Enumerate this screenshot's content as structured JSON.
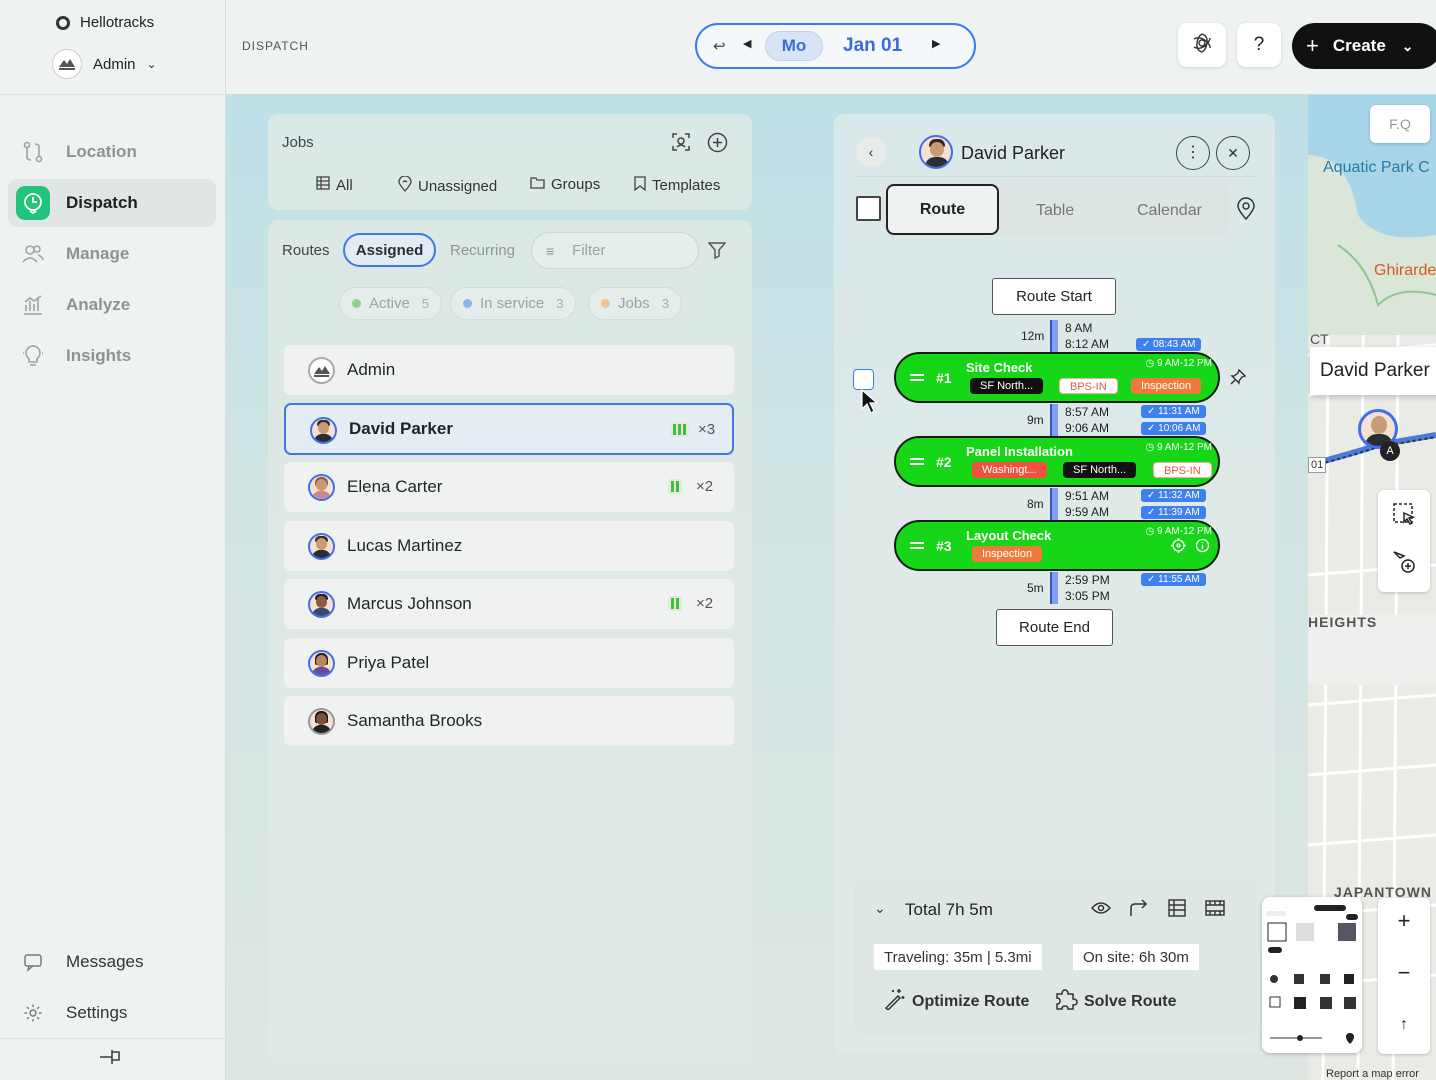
{
  "app": {
    "name": "Hellotracks",
    "user": "Admin"
  },
  "nav": {
    "items": [
      "Location",
      "Dispatch",
      "Manage",
      "Analyze",
      "Insights"
    ],
    "bottom": [
      "Messages",
      "Settings"
    ]
  },
  "header": {
    "section": "DISPATCH",
    "day": "Mo",
    "date": "Jan 01",
    "help": "?",
    "create": "Create"
  },
  "jobs_panel": {
    "title": "Jobs",
    "tabs": [
      "All",
      "Unassigned",
      "Groups",
      "Templates"
    ]
  },
  "routes_panel": {
    "label": "Routes",
    "tabs": [
      "Assigned",
      "Recurring"
    ],
    "filter_placeholder": "Filter",
    "chips": [
      {
        "label": "Active",
        "count": "5",
        "color": "#8fd18a"
      },
      {
        "label": "In service",
        "count": "3",
        "color": "#8fb0ef"
      },
      {
        "label": "Jobs",
        "count": "3",
        "color": "#f3c38f"
      }
    ],
    "routes": [
      {
        "name": "Admin",
        "mult": ""
      },
      {
        "name": "David Parker",
        "mult": "×3"
      },
      {
        "name": "Elena Carter",
        "mult": "×2"
      },
      {
        "name": "Lucas Martinez",
        "mult": ""
      },
      {
        "name": "Marcus Johnson",
        "mult": "×2"
      },
      {
        "name": "Priya Patel",
        "mult": ""
      },
      {
        "name": "Samantha Brooks",
        "mult": ""
      }
    ]
  },
  "detail": {
    "name": "David Parker",
    "tabs": [
      "Route",
      "Table",
      "Calendar"
    ],
    "route_start": "Route Start",
    "route_end": "Route End",
    "segments": [
      {
        "dur": "12m",
        "t1": "8 AM",
        "t2": "8:12 AM",
        "pill": "✓ 08:43 AM"
      },
      {
        "dur": "9m",
        "t1": "8:57 AM",
        "t2": "9:06 AM",
        "pill1": "✓ 11:31 AM",
        "pill2": "✓ 10:06 AM"
      },
      {
        "dur": "8m",
        "t1": "9:51 AM",
        "t2": "9:59 AM",
        "pill1": "✓ 11:32 AM",
        "pill2": "✓ 11:39 AM"
      },
      {
        "dur": "5m",
        "t1": "2:59 PM",
        "t2": "3:05 PM",
        "pill": "✓ 11:55 AM"
      }
    ],
    "jobs": [
      {
        "num": "#1",
        "title": "Site Check",
        "window": "◷ 9 AM-12 PM",
        "tags": [
          "SF North...",
          "BPS-IN",
          "Inspection"
        ]
      },
      {
        "num": "#2",
        "title": "Panel Installation",
        "window": "◷ 9 AM-12 PM",
        "tags": [
          "Washingt...",
          "SF North...",
          "BPS-IN"
        ]
      },
      {
        "num": "#3",
        "title": "Layout Check",
        "window": "◷ 9 AM-12 PM",
        "tags": [
          "Inspection"
        ]
      }
    ],
    "summary": {
      "total": "Total 7h 5m",
      "traveling": "Traveling: 35m | 5.3mi",
      "onsite": "On site: 6h 30m",
      "optimize": "Optimize Route",
      "solve": "Solve Route"
    }
  },
  "map": {
    "search": "F.Q",
    "labels": [
      "Aquatic Park C",
      "Ghirarde",
      "CT",
      "HEIGHTS",
      "JAPANTOWN",
      "Report a map error",
      "01"
    ],
    "driver_card": "David Parker",
    "marker": "A",
    "zoom_in": "+",
    "zoom_out": "−",
    "north": "↑"
  }
}
